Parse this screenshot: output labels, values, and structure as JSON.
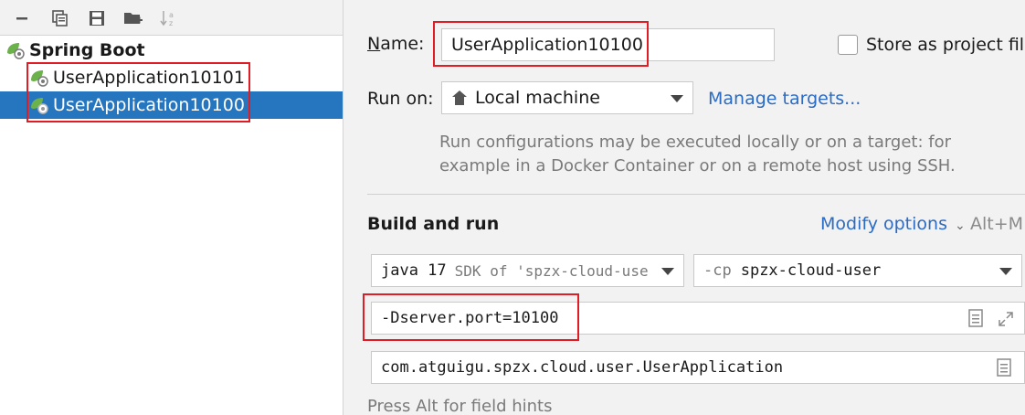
{
  "tree": {
    "group_label": "Spring Boot",
    "items": [
      {
        "label": "UserApplication10101"
      },
      {
        "label": "UserApplication10100"
      }
    ]
  },
  "form": {
    "name_label": "Name:",
    "name_value": "UserApplication10100",
    "store_label": "Store as project file",
    "store_checked": false,
    "run_on_label": "Run on:",
    "run_on_value": "Local machine",
    "manage_targets": "Manage targets...",
    "run_hint_line1": "Run configurations may be executed locally or on a target: for",
    "run_hint_line2": "example in a Docker Container or on a remote host using SSH.",
    "build_run_label": "Build and run",
    "modify_options": "Modify options",
    "modify_shortcut": "Alt+M",
    "jdk_java": "java 17",
    "jdk_sdk": "SDK of 'spzx-cloud-use",
    "cp_flag": "-cp",
    "cp_value": "spzx-cloud-user",
    "vm_options": "-Dserver.port=10100",
    "main_class": "com.atguigu.spzx.cloud.user.UserApplication",
    "footer_hint": "Press Alt for field hints"
  },
  "colors": {
    "selection": "#2675bf",
    "link": "#2c6bc3",
    "highlight_box": "#e01c24"
  }
}
